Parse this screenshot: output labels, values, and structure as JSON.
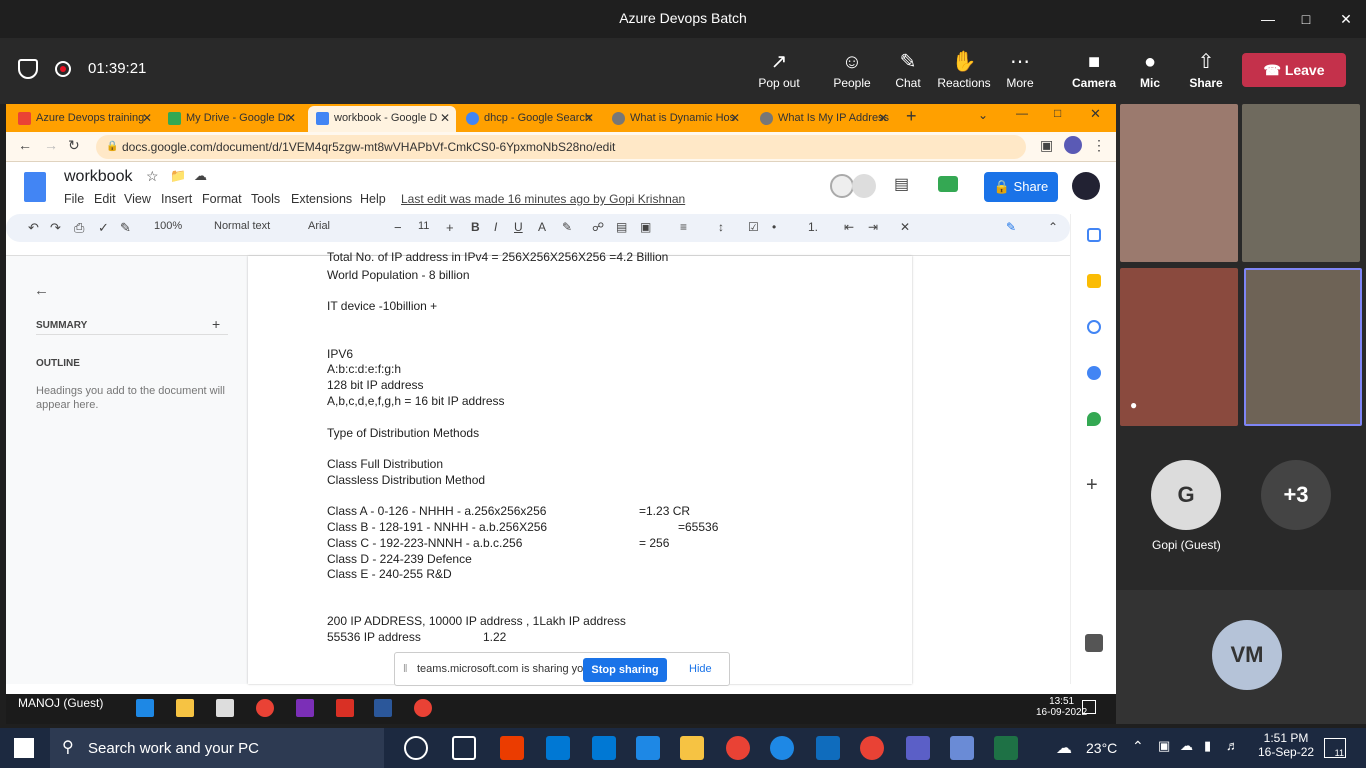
{
  "window": {
    "title": "Azure Devops Batch"
  },
  "meeting": {
    "timer": "01:39:21",
    "buttons": [
      {
        "label": "Pop out",
        "icon": "pop-out-icon"
      },
      {
        "label": "People",
        "icon": "people-icon"
      },
      {
        "label": "Chat",
        "icon": "chat-icon"
      },
      {
        "label": "Reactions",
        "icon": "reactions-icon"
      },
      {
        "label": "More",
        "icon": "more-icon"
      },
      {
        "label": "Camera",
        "icon": "camera-off-icon"
      },
      {
        "label": "Mic",
        "icon": "mic-off-icon"
      },
      {
        "label": "Share",
        "icon": "share-icon"
      }
    ],
    "leave": "Leave"
  },
  "browser": {
    "tabs": [
      {
        "label": "Azure Devops training",
        "color": "#ea4335"
      },
      {
        "label": "My Drive - Google Dr",
        "color": "#34a853"
      },
      {
        "label": "workbook - Google D",
        "color": "#4285f4"
      },
      {
        "label": "dhcp - Google Search",
        "color": "#4285f4"
      },
      {
        "label": "What is Dynamic Hos",
        "color": "#777777"
      },
      {
        "label": "What Is My IP Address",
        "color": "#777777"
      }
    ],
    "url": "docs.google.com/document/d/1VEM4qr5zgw-mt8wVHAPbVf-CmkCS0-6YpxmoNbS28no/edit"
  },
  "docs": {
    "name": "workbook",
    "menus": [
      "File",
      "Edit",
      "View",
      "Insert",
      "Format",
      "Tools",
      "Extensions",
      "Help"
    ],
    "last_edit": "Last edit was made 16 minutes ago by Gopi Krishnan",
    "share": "Share",
    "toolbar": {
      "zoom": "100%",
      "style": "Normal text",
      "font": "Arial",
      "size": "11"
    },
    "sidepane": {
      "summary": "SUMMARY",
      "outline": "OUTLINE",
      "hint": "Headings you add to the document will appear here."
    },
    "lines": [
      "Total No. of IP address in IPv4 = 256X256X256X256 =4.2 Billion",
      "World Population - 8 billion",
      "IT device -10billion +",
      "IPV6",
      "A:b:c:d:e:f:g:h",
      "128 bit IP address",
      "A,b,c,d,e,f,g,h = 16 bit IP address",
      "Type of Distribution Methods",
      "Class Full Distribution",
      "Classless Distribution Method",
      "Class A - 0-126  -   NHHH - a.256x256x256",
      "Class B - 128-191 - NNHH - a.b.256X256",
      "Class C - 192-223-NNNH - a.b.c.256",
      "Class D - 224-239   Defence",
      "Class E - 240-255   R&D",
      "200 IP ADDRESS, 10000 IP address ,  1Lakh IP address",
      "55536 IP address",
      "=1.23 CR",
      "=65536",
      "= 256",
      "1.22"
    ],
    "share_notice": {
      "text": "teams.microsoft.com is sharing your screen.",
      "stop": "Stop sharing",
      "hide": "Hide"
    }
  },
  "inner_taskbar": {
    "user": "MANOJ (Guest)",
    "time": "13:51",
    "date": "16-09-2022"
  },
  "participants": {
    "guest_initial": "G",
    "guest_name": "Gopi (Guest)",
    "more": "+3",
    "vm": "VM"
  },
  "taskbar": {
    "search": "Search work and your PC",
    "weather": "23°C",
    "time": "1:51 PM",
    "date": "16-Sep-22",
    "notifications": "11"
  }
}
